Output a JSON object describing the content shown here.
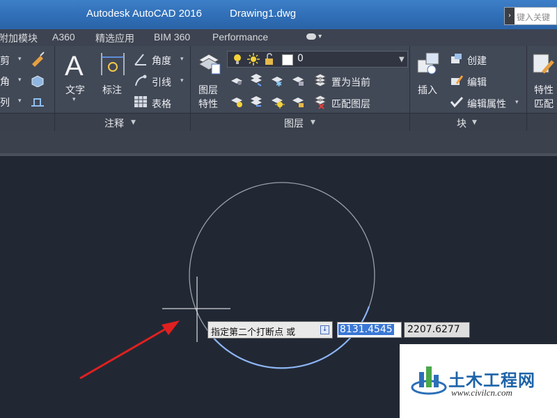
{
  "window": {
    "app_title": "Autodesk AutoCAD 2016",
    "document": "Drawing1.dwg"
  },
  "search": {
    "placeholder": "键入关键"
  },
  "tabs": [
    "附加模块",
    "A360",
    "精选应用",
    "BIM 360",
    "Performance"
  ],
  "ribbon": {
    "partial_left_labels": [
      "剪",
      "角",
      "列"
    ],
    "annotation": {
      "text_label": "文字",
      "dim_label": "标注",
      "angle_label": "角度",
      "leader_label": "引线",
      "table_label": "表格",
      "panel_title": "注释"
    },
    "layers": {
      "current_layer": "0",
      "set_current": "置为当前",
      "match_layer": "匹配图层",
      "layer_props_line1": "图层",
      "layer_props_line2": "特性",
      "panel_title": "图层"
    },
    "block": {
      "insert_label": "插入",
      "create_label": "创建",
      "edit_label": "编辑",
      "edit_attr_label": "编辑属性",
      "panel_title": "块"
    },
    "properties": {
      "label_line1": "特性",
      "label_line2": "匹配"
    }
  },
  "dynamic_input": {
    "prompt": "指定第二个打断点 或",
    "value1": "8131.4545",
    "value2": "2207.6277"
  },
  "watermark": {
    "brand": "土木工程网",
    "url": "www.civilcn.com"
  },
  "colors": {
    "canvas": "#212834",
    "highlight": "#6aa6ff",
    "arrow": "#e02020",
    "title_bar": "#2f6db5"
  }
}
